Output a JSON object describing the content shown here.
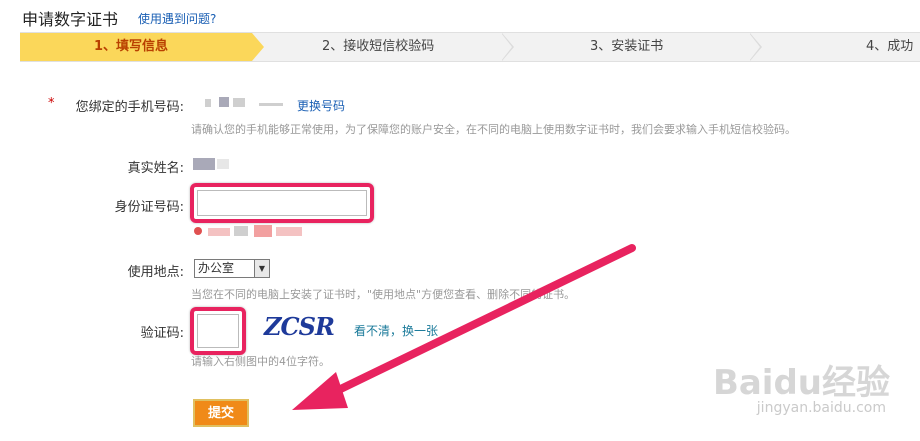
{
  "header": {
    "title": "申请数字证书",
    "help_link": "使用遇到问题?"
  },
  "steps": [
    {
      "label": "1、填写信息",
      "active": true
    },
    {
      "label": "2、接收短信校验码",
      "active": false
    },
    {
      "label": "3、安装证书",
      "active": false
    },
    {
      "label": "4、成功",
      "active": false
    }
  ],
  "form": {
    "phone": {
      "required_mark": "*",
      "label": "您绑定的手机号码:",
      "change_link": "更换号码",
      "hint": "请确认您的手机能够正常使用，为了保障您的账户安全，在不同的电脑上使用数字证书时，我们会要求输入手机短信校验码。"
    },
    "real_name": {
      "label": "真实姓名:"
    },
    "id_number": {
      "label": "身份证号码:",
      "value": ""
    },
    "location": {
      "label": "使用地点:",
      "selected": "办公室",
      "hint": "当您在不同的电脑上安装了证书时，\"使用地点\"方便您查看、删除不同的证书。"
    },
    "captcha": {
      "label": "验证码:",
      "value": "",
      "image_text": "ZCSR",
      "refresh_link": "看不清，换一张",
      "hint": "请输入右侧图中的4位字符。"
    },
    "submit_label": "提交"
  },
  "watermark": {
    "text": "Baidu经验",
    "sub": "jingyan.baidu.com"
  },
  "colors": {
    "accent": "#fbd75a",
    "highlight": "#e8235f",
    "submit": "#f08a18",
    "link": "#1a5fb4"
  }
}
